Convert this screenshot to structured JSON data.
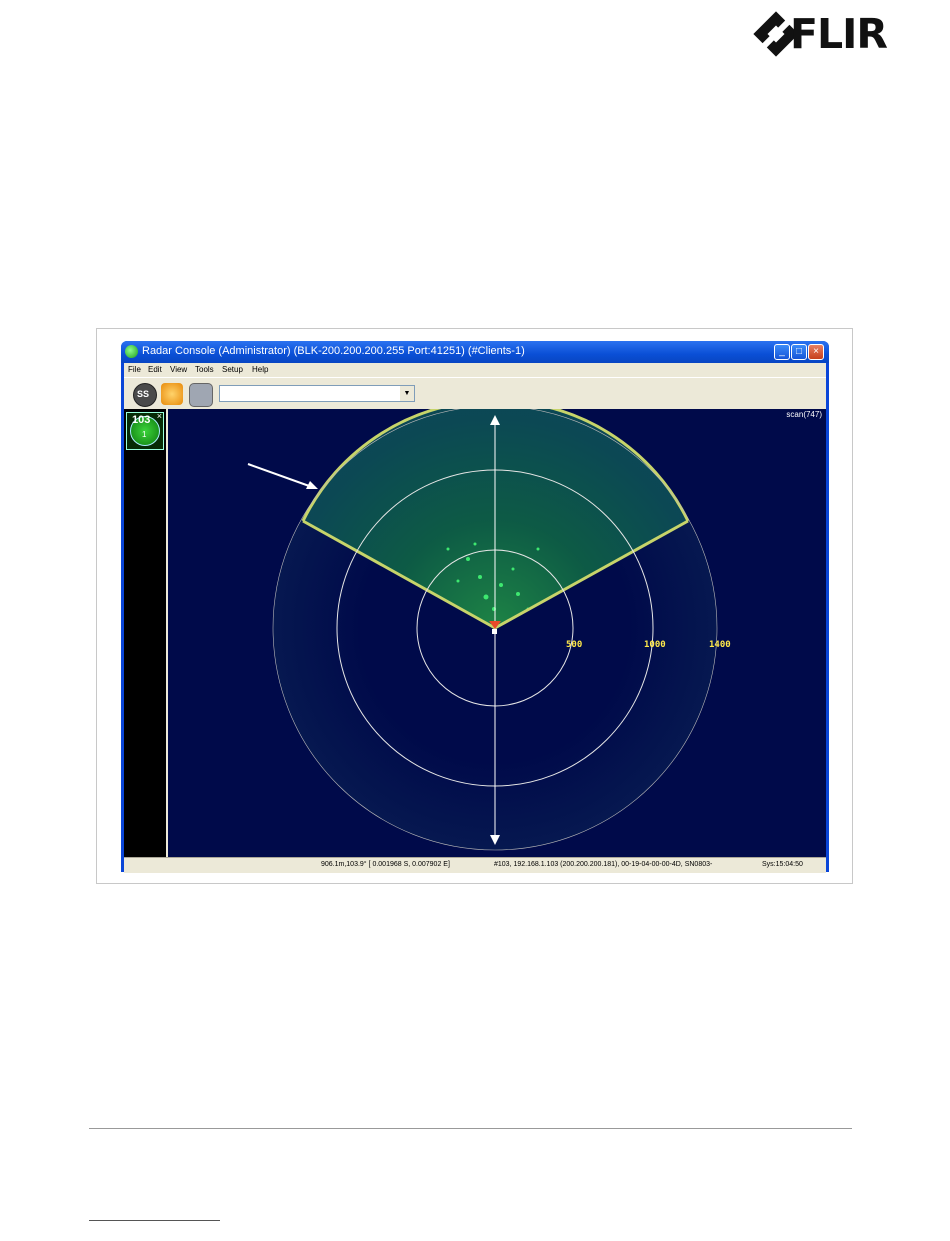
{
  "brand": {
    "logo_text": "FLIR"
  },
  "window": {
    "title": "Radar Console (Administrator) (BLK-200.200.200.255 Port:41251) (#Clients-1)",
    "controls": [
      "minimize",
      "maximize",
      "close"
    ]
  },
  "menu": [
    "File",
    "Edit",
    "View",
    "Tools",
    "Setup",
    "Help"
  ],
  "toolbar": {
    "buttons": [
      {
        "label": "SS",
        "icon": "ss-icon"
      },
      {
        "label": "",
        "icon": "radar-settings-icon"
      },
      {
        "label": "",
        "icon": "camera-icon"
      }
    ],
    "combo_value": ""
  },
  "radar_list": {
    "id": "103",
    "sub": "1",
    "close": "×"
  },
  "radar": {
    "scan_label": "scan(747)",
    "range_labels": [
      "500",
      "1000",
      "1400"
    ]
  },
  "status": {
    "position": "906.1m,103.9° [ 0.001968 S,   0.007902 E]",
    "connection": "#103, 192.168.1.103 (200.200.200.181), 00-19-04-00-00-4D, SN0803-",
    "time": "Sys:15:04:50"
  }
}
